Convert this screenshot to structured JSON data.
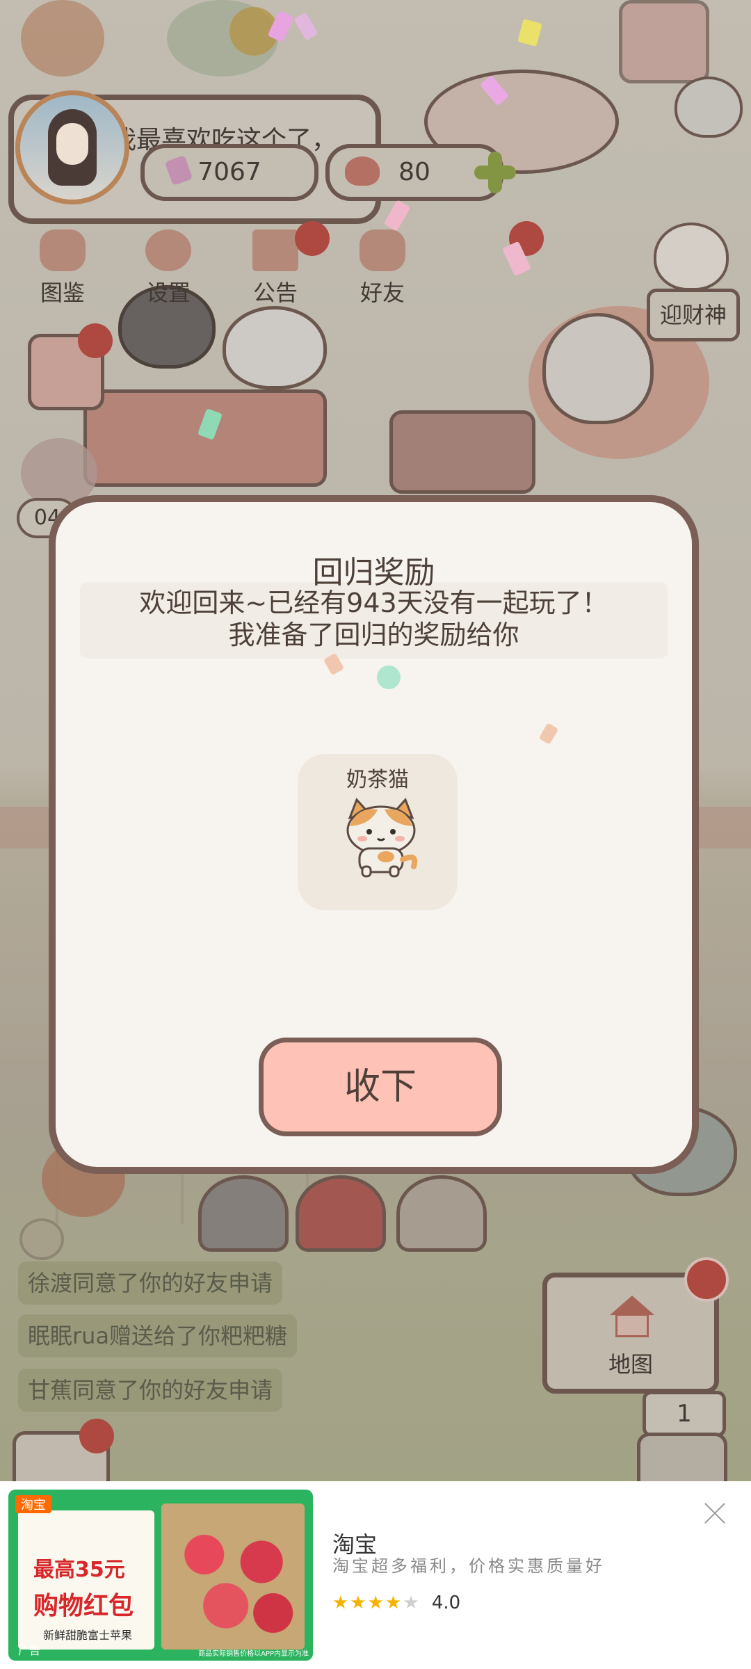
{
  "profile": {
    "status_text": "我最喜欢吃这个了，",
    "coins": "7067",
    "hearts": "80"
  },
  "menu": [
    {
      "label": "图鉴"
    },
    {
      "label": "设置"
    },
    {
      "label": "公告"
    },
    {
      "label": "好友"
    }
  ],
  "side_buttons": {
    "fortune_god": "迎财神",
    "left_counter": "04",
    "map": "地图",
    "level": "1"
  },
  "feed": [
    "徐渡同意了你的好友申请",
    "眠眠rua赠送给了你粑粑糖",
    "甘蕉同意了你的好友申请"
  ],
  "dialog": {
    "title": "回归奖励",
    "message_line1": "欢迎回来~已经有943天没有一起玩了！",
    "message_line2": "我准备了回归的奖励给你",
    "reward_name": "奶茶猫",
    "collect_button": "收下"
  },
  "ad": {
    "image_brand": "淘宝",
    "image_line1": "最高35元",
    "image_line2": "购物红包",
    "image_sub": "新鲜甜脆富士苹果",
    "image_tag": "广告",
    "image_disclaimer": "商品实际销售价格以APP内显示为准",
    "title": "淘宝",
    "description": "淘宝超多福利，价格实惠质量好",
    "rating": "4.0",
    "rating_value": 4.0
  },
  "colors": {
    "dialog_border": "#7b5e55",
    "dialog_bg": "#f7f4ef",
    "button_bg": "#ffc2b6",
    "notification_red": "#c0493f",
    "star": "#f5b300"
  }
}
